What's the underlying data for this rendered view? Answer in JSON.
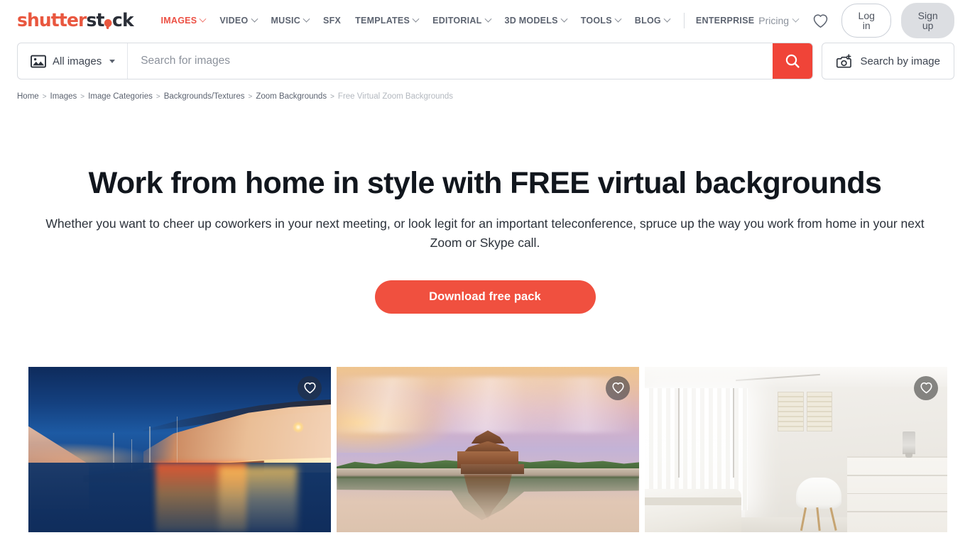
{
  "header": {
    "logo": {
      "part1": "shutter",
      "part2": "st",
      "part3": "ck",
      "alt": "shutterstock"
    },
    "nav": [
      {
        "label": "IMAGES",
        "has_dropdown": true,
        "active": true
      },
      {
        "label": "VIDEO",
        "has_dropdown": true,
        "active": false
      },
      {
        "label": "MUSIC",
        "has_dropdown": true,
        "active": false
      },
      {
        "label": "SFX",
        "has_dropdown": false,
        "active": false
      },
      {
        "label": "TEMPLATES",
        "has_dropdown": true,
        "active": false
      },
      {
        "label": "EDITORIAL",
        "has_dropdown": true,
        "active": false
      },
      {
        "label": "3D MODELS",
        "has_dropdown": true,
        "active": false
      },
      {
        "label": "TOOLS",
        "has_dropdown": true,
        "active": false
      },
      {
        "label": "BLOG",
        "has_dropdown": true,
        "active": false
      }
    ],
    "enterprise_label": "ENTERPRISE",
    "pricing_label": "Pricing",
    "favorites_icon": "heart-icon",
    "login_label": "Log in",
    "signup_label": "Sign up"
  },
  "search": {
    "type_label": "All images",
    "type_icon": "image-icon",
    "placeholder": "Search for images",
    "value": "",
    "submit_icon": "search-icon",
    "by_image_label": "Search by image",
    "by_image_icon": "camera-plus-icon"
  },
  "breadcrumb": {
    "items": [
      {
        "label": "Home",
        "current": false
      },
      {
        "label": "Images",
        "current": false
      },
      {
        "label": "Image Categories",
        "current": false
      },
      {
        "label": "Backgrounds/Textures",
        "current": false
      },
      {
        "label": "Zoom Backgrounds",
        "current": false
      },
      {
        "label": "Free Virtual Zoom Backgrounds",
        "current": true
      }
    ],
    "separator": ">"
  },
  "hero": {
    "title": "Work from home in style with FREE virtual backgrounds",
    "subtitle": "Whether you want to cheer up coworkers in your next meeting, or look legit for an important teleconference, spruce up the way you work from home in your next Zoom or Skype call.",
    "cta_label": "Download free pack"
  },
  "gallery": {
    "favorite_icon": "heart-icon",
    "cards": [
      {
        "name": "nyhavn-canal-copenhagen-at-dusk",
        "alt": "Colorful waterfront townhouses reflected in a canal at blue hour"
      },
      {
        "name": "forbidden-city-corner-tower-at-sunset",
        "alt": "Palace corner tower mirrored in still water under a pastel sunset sky"
      },
      {
        "name": "bright-white-minimalist-bedroom",
        "alt": "White bedroom with sheer curtains, molded chair and a dresser"
      }
    ]
  },
  "colors": {
    "brand_red": "#ec5044",
    "cta_red": "#f0503f",
    "search_red": "#f04438",
    "nav_text": "#5c6370",
    "muted_text": "#8c929c",
    "breadcrumb_current": "#b3b8bf",
    "signup_bg": "#dcdee2",
    "heading": "#11161d"
  }
}
